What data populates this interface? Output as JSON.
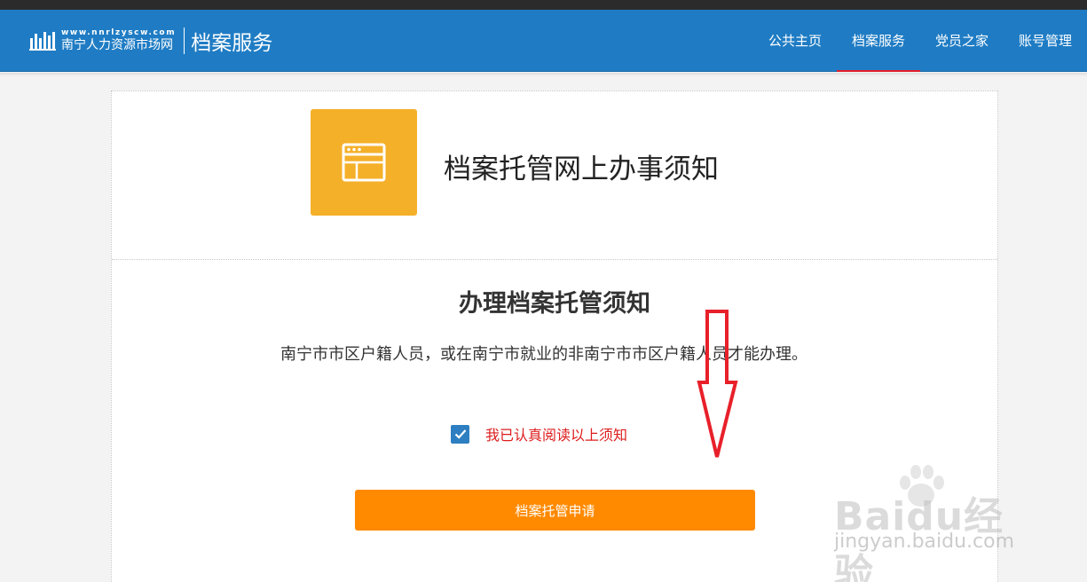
{
  "header": {
    "logo_url_text": "www.nnrlzyscw.com",
    "logo_name": "南宁人力资源市场网",
    "section_title": "档案服务",
    "nav": [
      {
        "label": "公共主页",
        "active": false
      },
      {
        "label": "档案服务",
        "active": true
      },
      {
        "label": "党员之家",
        "active": false
      },
      {
        "label": "账号管理",
        "active": false
      }
    ]
  },
  "main": {
    "page_heading": "档案托管网上办事须知",
    "notice_title": "办理档案托管须知",
    "notice_text": "南宁市市区户籍人员，或在南宁市就业的非南宁市市区户籍人员才能办理。",
    "agree_label": "我已认真阅读以上须知",
    "agree_checked": true,
    "apply_button": "档案托管申请"
  },
  "watermark": {
    "brand": "Baidu经验",
    "domain": "jingyan.baidu.com"
  },
  "colors": {
    "header_blue": "#1f7cc4",
    "icon_yellow": "#f5b02a",
    "button_orange": "#ff8a00",
    "agree_red": "#dd1c1c",
    "annotation_red": "#e8202a"
  },
  "icons": {
    "logo": "nnrl-logo-icon",
    "heading": "browser-window-icon",
    "checkbox": "check-icon",
    "annotation": "down-arrow-icon"
  }
}
